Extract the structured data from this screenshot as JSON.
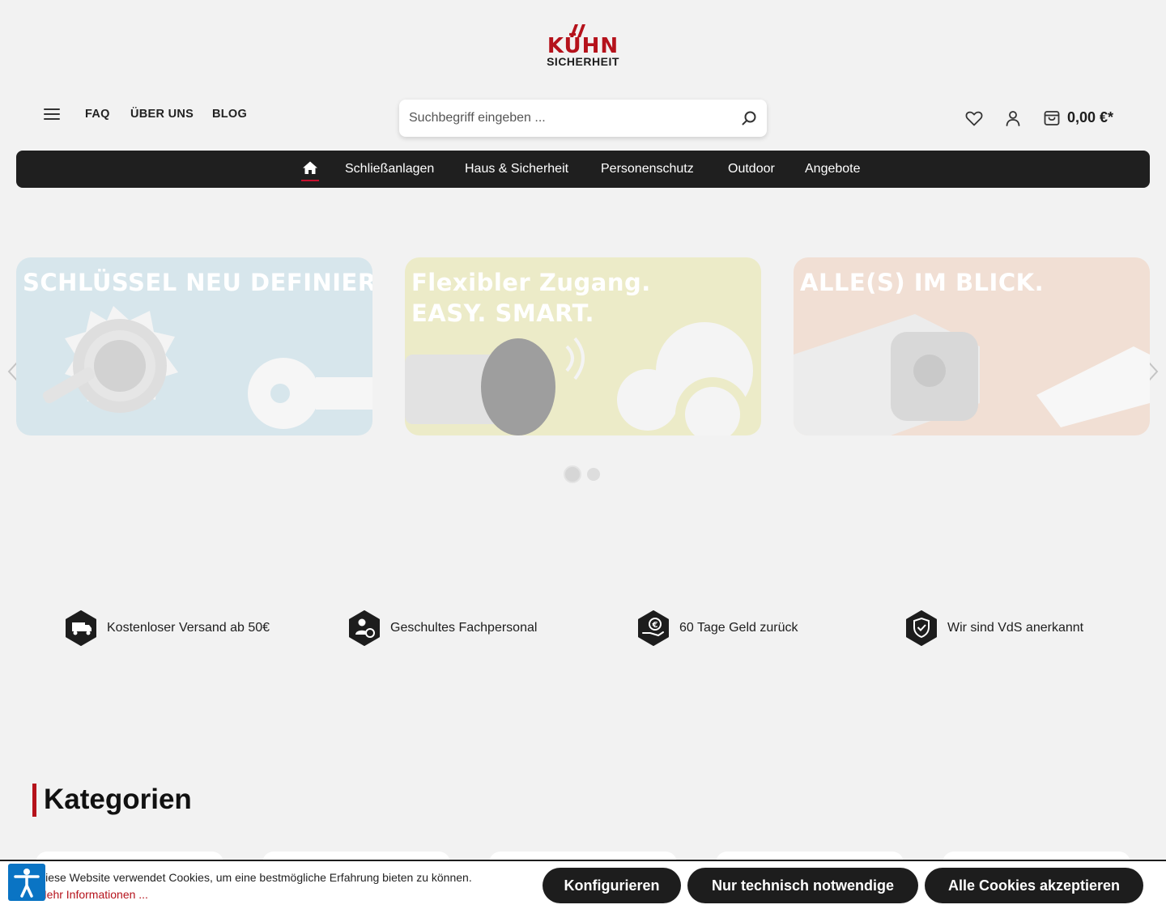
{
  "brand": {
    "name_line1": "KÜHN",
    "name_line2": "SICHERHEIT",
    "red": "#b5121b",
    "dark": "#1d1d1d"
  },
  "topnav": {
    "faq": "FAQ",
    "about": "ÜBER UNS",
    "blog": "BLOG"
  },
  "search": {
    "placeholder": "Suchbegriff eingeben ..."
  },
  "cart": {
    "total": "0,00 €*"
  },
  "mainnav": {
    "items": [
      "Schließanlagen",
      "Haus & Sicherheit",
      "Personenschutz",
      "Outdoor",
      "Angebote"
    ]
  },
  "slider": {
    "slides": [
      {
        "headline_1": "SCHLÜSSEL NEU DEFINIERT",
        "headline_2": ""
      },
      {
        "headline_1": "Flexibler Zugang.",
        "headline_2": "EASY. SMART."
      },
      {
        "headline_1": "ALLE(S) IM BLICK.",
        "headline_2": ""
      }
    ],
    "dots": 2,
    "active_dot": 1
  },
  "usps": [
    {
      "icon": "free-shipping-truck-icon",
      "text": "Kostenloser Versand ab 50€"
    },
    {
      "icon": "trained-staff-icon",
      "text": "Geschultes Fachpersonal"
    },
    {
      "icon": "money-back-icon",
      "text": "60 Tage Geld zurück"
    },
    {
      "icon": "vds-shield-icon",
      "text": "Wir sind VdS anerkannt"
    }
  ],
  "categories": {
    "title": "Kategorien"
  },
  "cookie": {
    "message": "Diese Website verwendet Cookies, um eine bestmögliche Erfahrung bieten zu können.",
    "more": "Mehr Informationen ...",
    "btn_configure": "Konfigurieren",
    "btn_necessary": "Nur technisch notwendige",
    "btn_accept_all": "Alle Cookies akzeptieren"
  }
}
